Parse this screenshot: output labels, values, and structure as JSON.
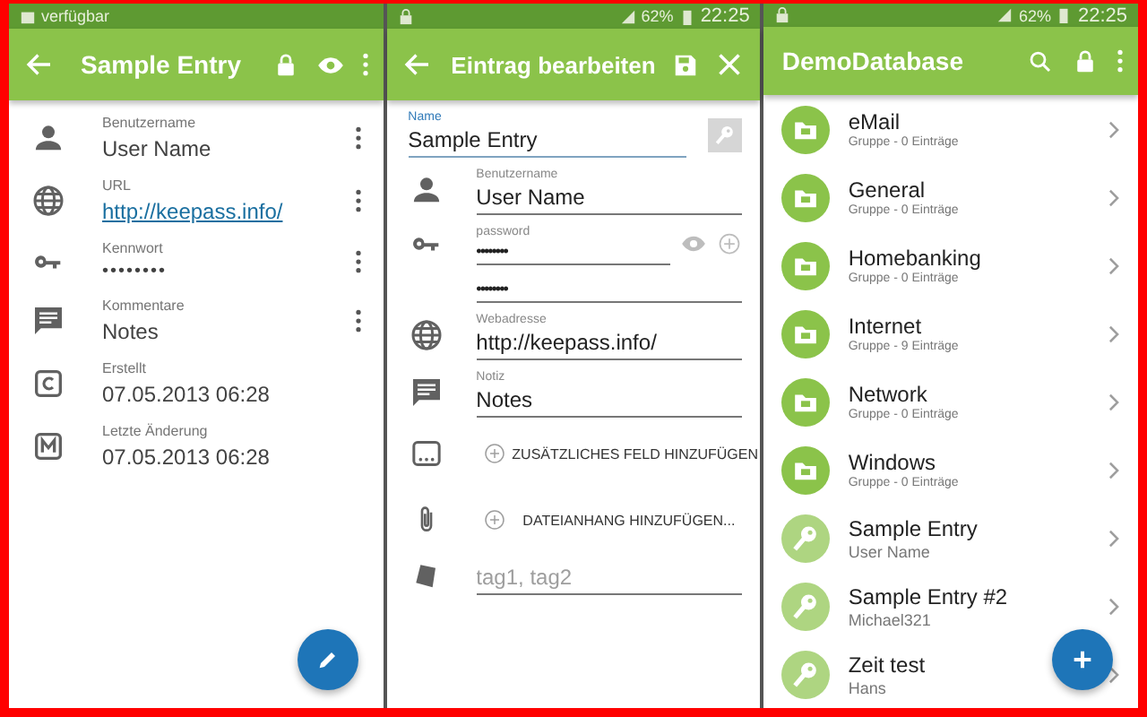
{
  "detail_screen": {
    "status_bar": {
      "text": "verfügbar"
    },
    "title": "Sample Entry",
    "fields": [
      {
        "kind": "user",
        "label": "Benutzername",
        "value": "User Name",
        "menu": true
      },
      {
        "kind": "url",
        "label": "URL",
        "value": "http://keepass.info/",
        "menu": true
      },
      {
        "kind": "password",
        "label": "Kennwort",
        "value": "••••••••",
        "menu": true
      },
      {
        "kind": "notes",
        "label": "Kommentare",
        "value": "Notes",
        "menu": true
      },
      {
        "kind": "created",
        "label": "Erstellt",
        "value": "07.05.2013 06:28",
        "menu": false
      },
      {
        "kind": "modified",
        "label": "Letzte Änderung",
        "value": "07.05.2013 06:28",
        "menu": false
      }
    ]
  },
  "edit_screen": {
    "status_bar": {
      "battery": "62%",
      "time": "22:25"
    },
    "title": "Eintrag bearbeiten",
    "name_field": {
      "label": "Name",
      "value": "Sample Entry",
      "focused": true
    },
    "fields": [
      {
        "kind": "user",
        "label": "Benutzername",
        "value": "User Name"
      },
      {
        "kind": "password",
        "label": "password",
        "value": "••••••••"
      },
      {
        "kind": "confirm",
        "value": "••••••••"
      },
      {
        "kind": "url",
        "label": "Webadresse",
        "value": "http://keepass.info/"
      },
      {
        "kind": "notes",
        "label": "Notiz",
        "value": "Notes"
      }
    ],
    "actions": [
      {
        "kind": "field",
        "label": "ZUSÄTZLICHES FELD HINZUFÜGEN"
      },
      {
        "kind": "file",
        "label": "DATEIANHANG HINZUFÜGEN..."
      }
    ],
    "tags": {
      "placeholder": "tag1, tag2"
    }
  },
  "list_screen": {
    "status_bar": {
      "battery": "62%",
      "time": "22:25"
    },
    "title": "DemoDatabase",
    "items": [
      {
        "kind": "group",
        "title": "eMail",
        "subtitle": "Gruppe - 0 Einträge"
      },
      {
        "kind": "group",
        "title": "General",
        "subtitle": "Gruppe - 0 Einträge"
      },
      {
        "kind": "group",
        "title": "Homebanking",
        "subtitle": "Gruppe - 0 Einträge"
      },
      {
        "kind": "group",
        "title": "Internet",
        "subtitle": "Gruppe - 9 Einträge"
      },
      {
        "kind": "group",
        "title": "Network",
        "subtitle": "Gruppe - 0 Einträge"
      },
      {
        "kind": "group",
        "title": "Windows",
        "subtitle": "Gruppe - 0 Einträge"
      },
      {
        "kind": "entry",
        "title": "Sample Entry",
        "subtitle": "User Name"
      },
      {
        "kind": "entry",
        "title": "Sample Entry #2",
        "subtitle": "Michael321"
      },
      {
        "kind": "entry",
        "title": "Zeit test",
        "subtitle": "Hans"
      }
    ]
  }
}
